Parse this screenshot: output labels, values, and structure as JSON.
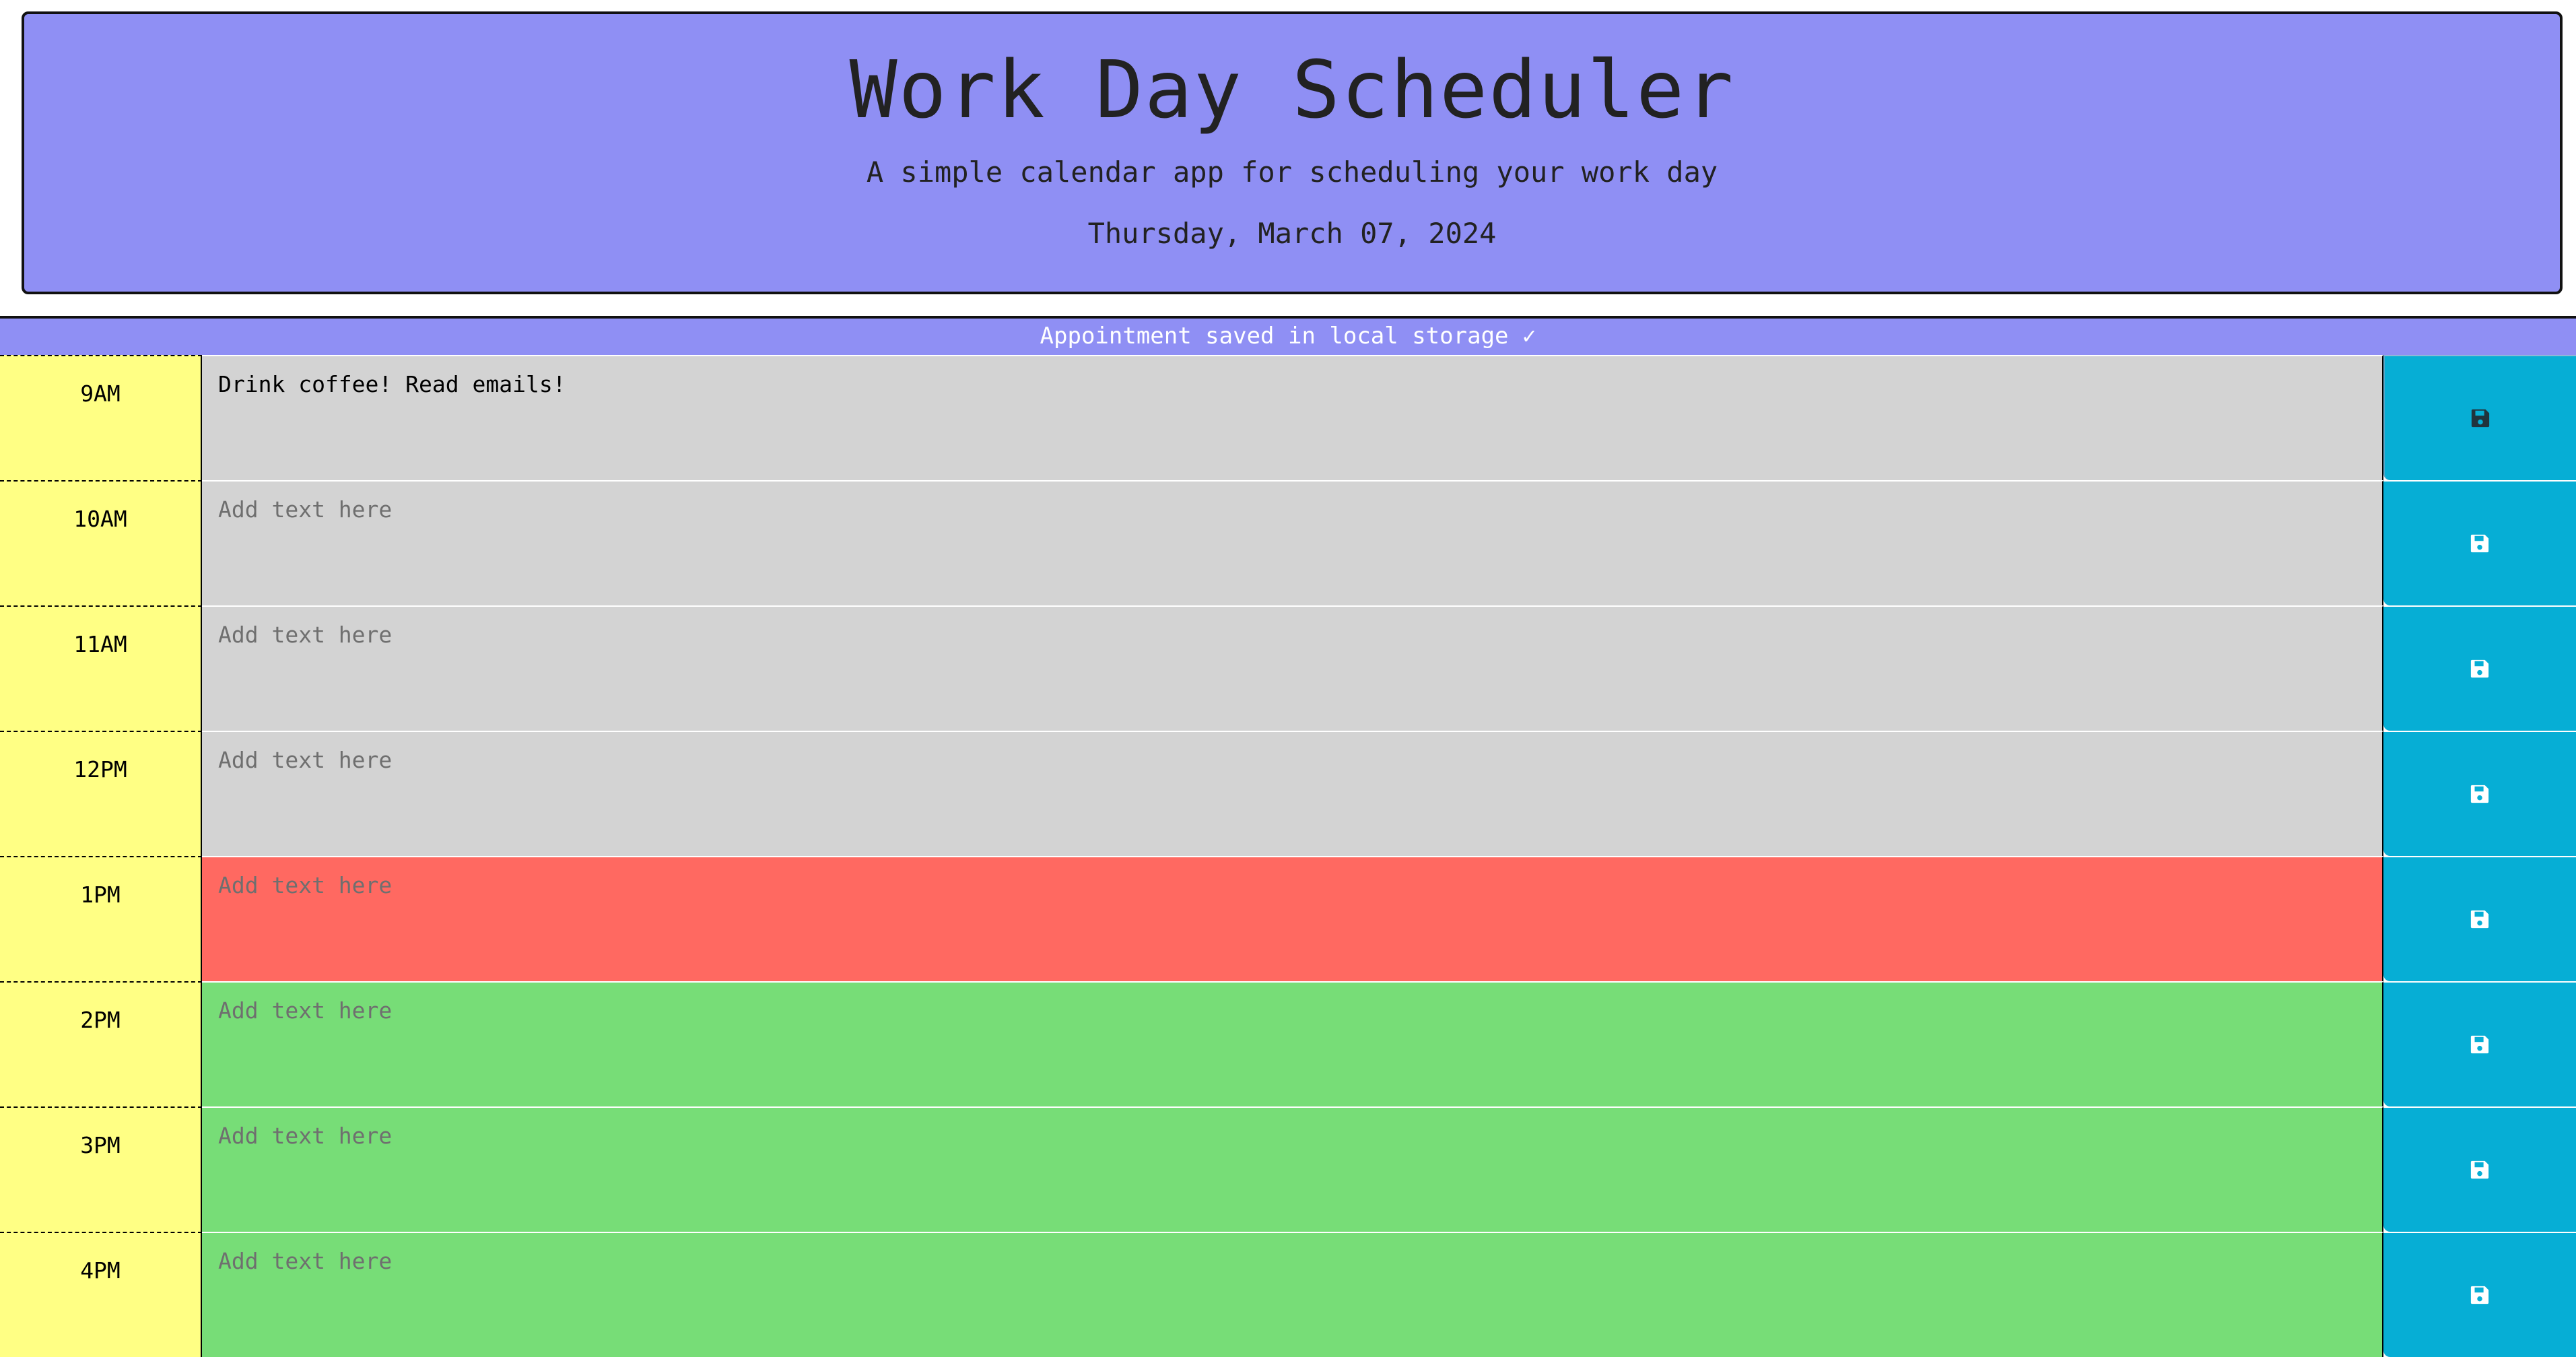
{
  "header": {
    "title": "Work Day Scheduler",
    "subtitle": "A simple calendar app for scheduling your work day",
    "current_day": "Thursday, March 07, 2024"
  },
  "status": {
    "message": "Appointment saved in local storage ✓"
  },
  "colors": {
    "header_bg": "#8f8ff4",
    "hour_bg": "#ffff84",
    "past": "#d3d3d3",
    "present": "#ff6961",
    "future": "#77dd77",
    "save_button": "#06aed5"
  },
  "placeholder": "Add text here",
  "rows": [
    {
      "hour": "9AM",
      "text": "Drink coffee! Read emails!",
      "state": "past"
    },
    {
      "hour": "10AM",
      "text": "",
      "state": "past"
    },
    {
      "hour": "11AM",
      "text": "",
      "state": "past"
    },
    {
      "hour": "12PM",
      "text": "",
      "state": "past"
    },
    {
      "hour": "1PM",
      "text": "",
      "state": "present"
    },
    {
      "hour": "2PM",
      "text": "",
      "state": "future"
    },
    {
      "hour": "3PM",
      "text": "",
      "state": "future"
    },
    {
      "hour": "4PM",
      "text": "",
      "state": "future"
    }
  ],
  "icons": {
    "save": "floppy-disk-icon"
  }
}
